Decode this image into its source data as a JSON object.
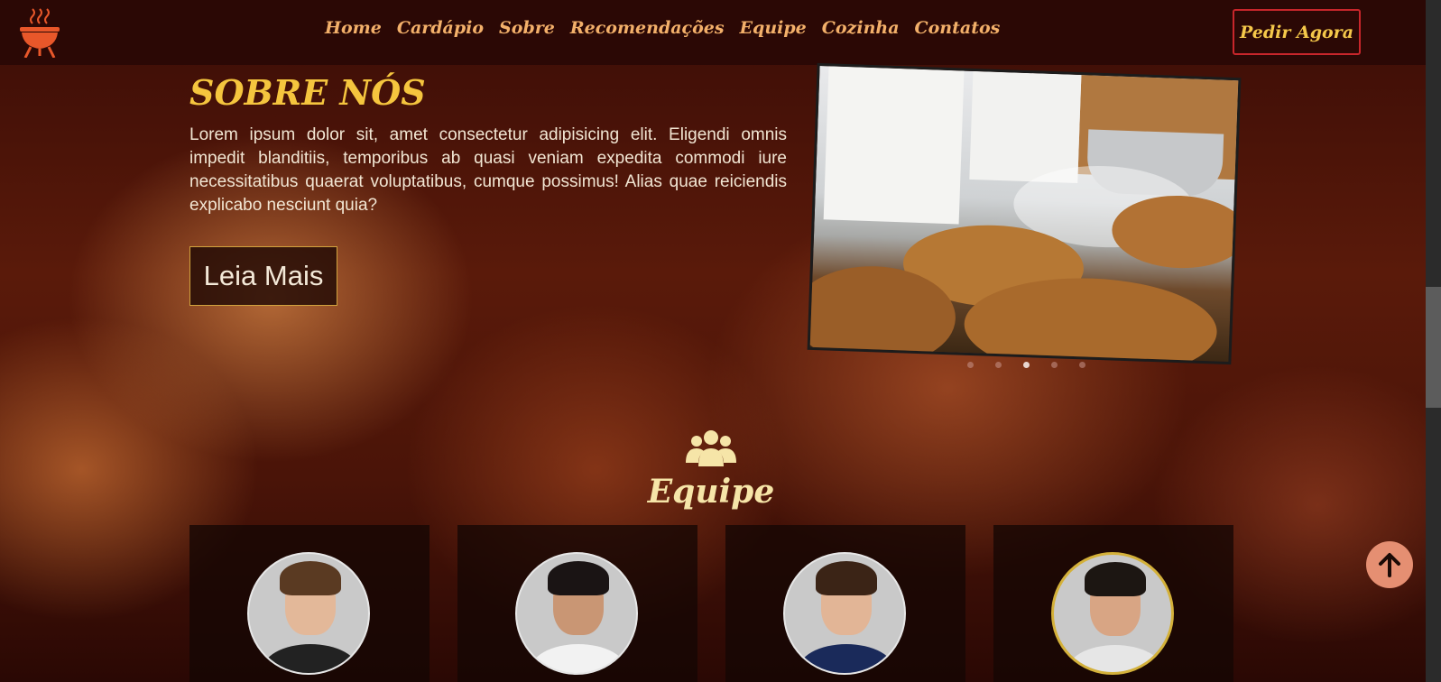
{
  "nav": {
    "links": [
      "Home",
      "Cardápio",
      "Sobre",
      "Recomendações",
      "Equipe",
      "Cozinha",
      "Contatos"
    ],
    "order_label": "Pedir Agora"
  },
  "about": {
    "title": "SOBRE NÓS",
    "text": "Lorem ipsum dolor sit, amet consectetur adipisicing elit. Eligendi omnis impedit blanditiis, temporibus ab quasi veniam expedita commodi iure necessitatibus quaerat voluptatibus, cumque possimus! Alias quae reiciendis explicabo nesciunt quia?",
    "read_more_label": "Leia Mais",
    "carousel": {
      "slides": 5,
      "active_index": 2
    }
  },
  "team": {
    "icon": "users-icon",
    "title": "Equipe",
    "members": [
      {
        "avatar": "woman-long-hair",
        "hair": "#5a3a22",
        "shirt": "#222222",
        "skin": "#e3b899"
      },
      {
        "avatar": "man-short-hair",
        "hair": "#1a1414",
        "shirt": "#f2f2f2",
        "skin": "#c99674"
      },
      {
        "avatar": "woman-glasses",
        "hair": "#3b2416",
        "shirt": "#1a2a5a",
        "skin": "#e2b596"
      },
      {
        "avatar": "man-beard",
        "hair": "#1c1612",
        "shirt": "#e6e6e6",
        "skin": "#d8a584"
      }
    ]
  },
  "colors": {
    "nav_bg": "#2b0805",
    "nav_link": "#f3b06a",
    "accent_gold": "#f5c53e",
    "order_border": "#c8262b",
    "scroll_top_bg": "#e58f72"
  },
  "icons": {
    "logo": "grill-icon",
    "scroll_top": "arrow-up-icon"
  }
}
